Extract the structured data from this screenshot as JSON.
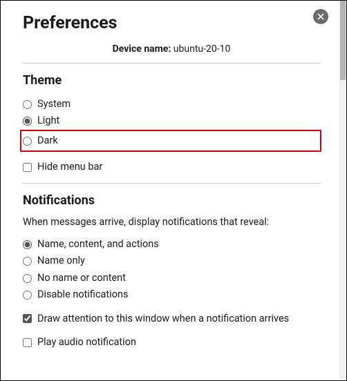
{
  "title": "Preferences",
  "device": {
    "label": "Device name:",
    "value": "ubuntu-20-10"
  },
  "theme": {
    "heading": "Theme",
    "options": {
      "system": "System",
      "light": "Light",
      "dark": "Dark"
    },
    "hide_menu_bar": "Hide menu bar"
  },
  "notifications": {
    "heading": "Notifications",
    "intro": "When messages arrive, display notifications that reveal:",
    "options": {
      "full": "Name, content, and actions",
      "name_only": "Name only",
      "none": "No name or content",
      "disabled": "Disable notifications"
    },
    "draw_attention": "Draw attention to this window when a notification arrives",
    "play_audio": "Play audio notification"
  }
}
